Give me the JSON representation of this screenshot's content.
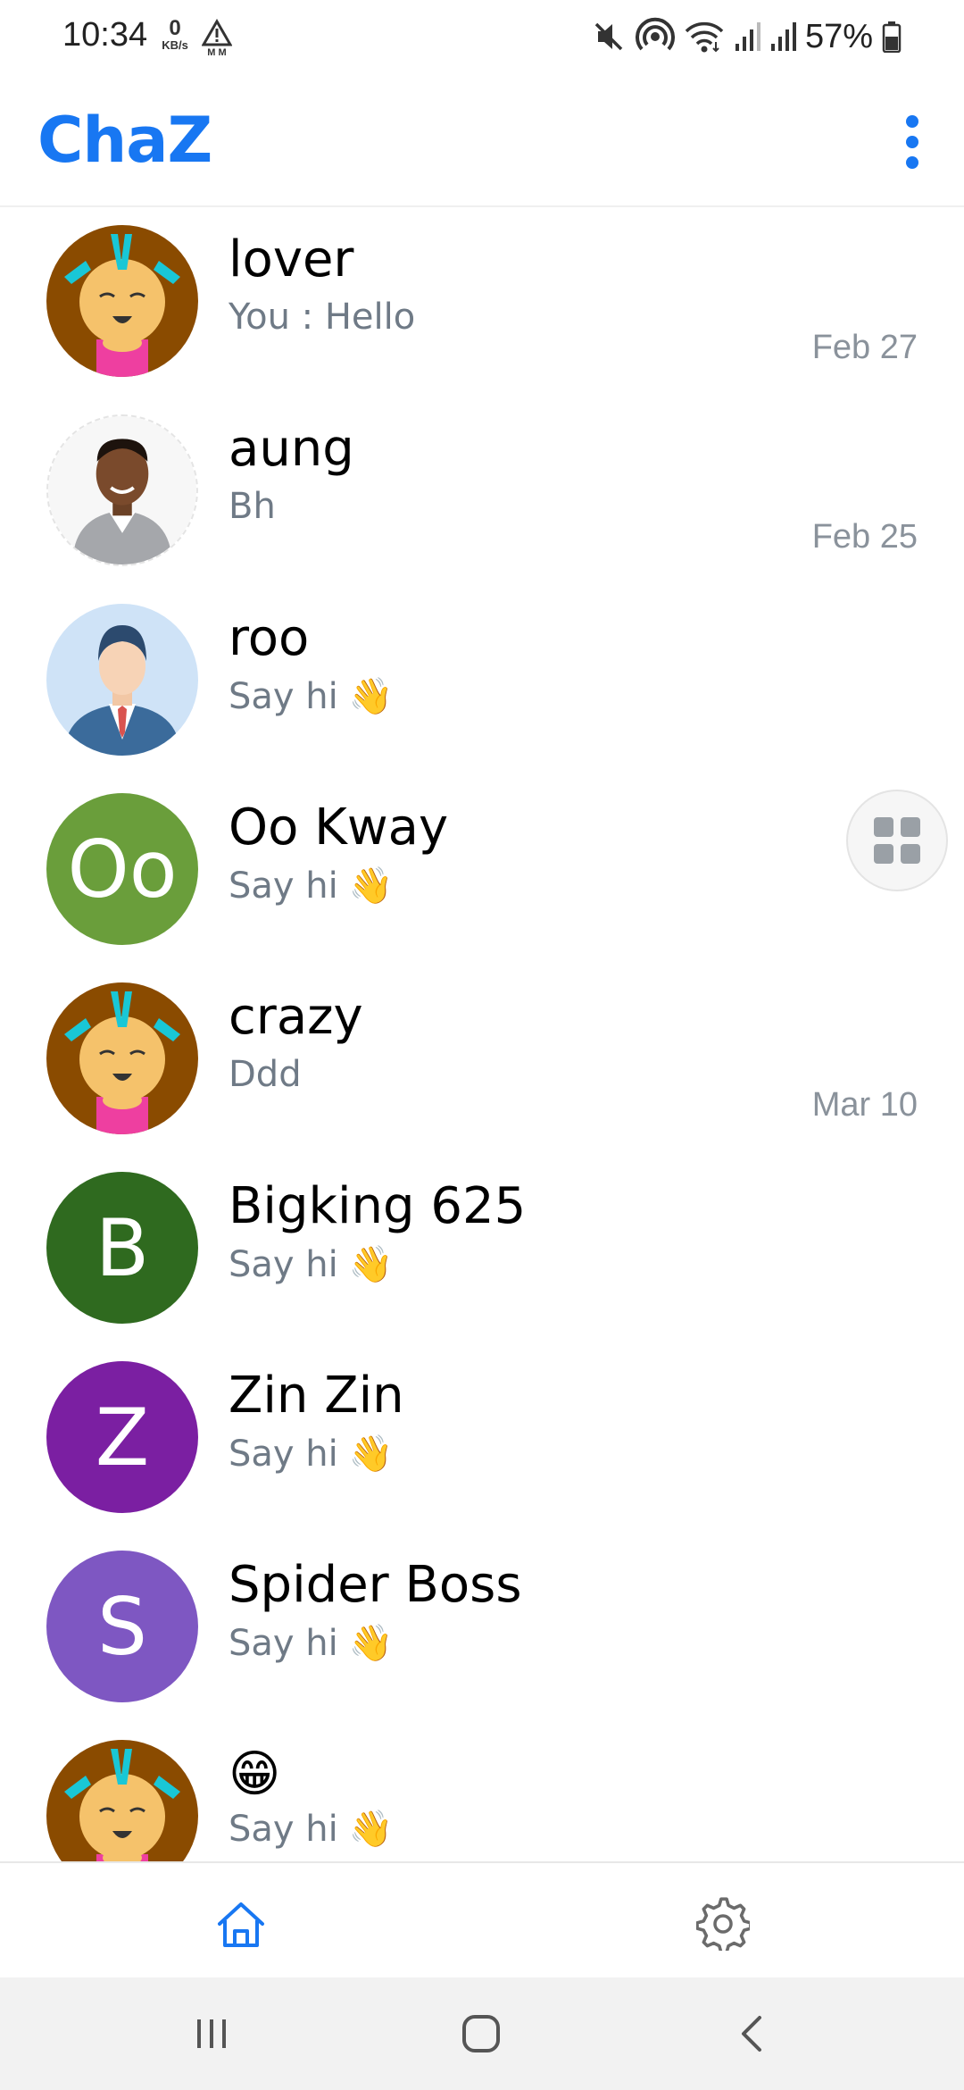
{
  "status_bar": {
    "time": "10:34",
    "net_speed_value": "0",
    "net_speed_unit": "KB/s",
    "battery": "57%",
    "icons": [
      "alert-icon",
      "mute-icon",
      "hotspot-icon",
      "wifi-icon",
      "signal-icon",
      "signal-icon",
      "battery-icon"
    ]
  },
  "app_bar": {
    "title": "ChaZ",
    "menu_icon": "more-vert-icon",
    "accent": "#1877f2"
  },
  "chats": [
    {
      "name": "lover",
      "preview": "You : Hello",
      "wave": "",
      "date": "Feb 27",
      "avatar": "cartoon-girl"
    },
    {
      "name": "aung",
      "preview": "Bh",
      "wave": "",
      "date": "Feb 25",
      "avatar": "photo-man"
    },
    {
      "name": "roo",
      "preview": "Say hi",
      "wave": "👋",
      "date": "",
      "avatar": "businessman"
    },
    {
      "name": "Oo Kway",
      "preview": "Say hi",
      "wave": "👋",
      "date": "",
      "avatar": "letter",
      "letter": "Oo",
      "color": "#6a9e3b"
    },
    {
      "name": "crazy",
      "preview": "Ddd",
      "wave": "",
      "date": "Mar 10",
      "avatar": "cartoon-girl"
    },
    {
      "name": "Bigking 625",
      "preview": "Say hi",
      "wave": "👋",
      "date": "",
      "avatar": "letter",
      "letter": "B",
      "color": "#2f6a1f"
    },
    {
      "name": "Zin Zin",
      "preview": "Say hi",
      "wave": "👋",
      "date": "",
      "avatar": "letter",
      "letter": "Z",
      "color": "#7b1fa2"
    },
    {
      "name": "Spider Boss",
      "preview": "Say hi",
      "wave": "👋",
      "date": "",
      "avatar": "letter",
      "letter": "S",
      "color": "#7e57c2"
    },
    {
      "name": "😁",
      "preview": "Say hi",
      "wave": "👋",
      "date": "",
      "avatar": "cartoon-girl"
    }
  ],
  "float_button": {
    "icon": "grid-icon"
  },
  "bottom_nav": {
    "items": [
      {
        "icon": "home-icon",
        "active": true,
        "color": "#1877f2"
      },
      {
        "icon": "settings-icon",
        "active": false,
        "color": "#6b6b6b"
      }
    ]
  },
  "system_nav": {
    "items": [
      "recents-icon",
      "home-circle-icon",
      "back-icon"
    ]
  }
}
